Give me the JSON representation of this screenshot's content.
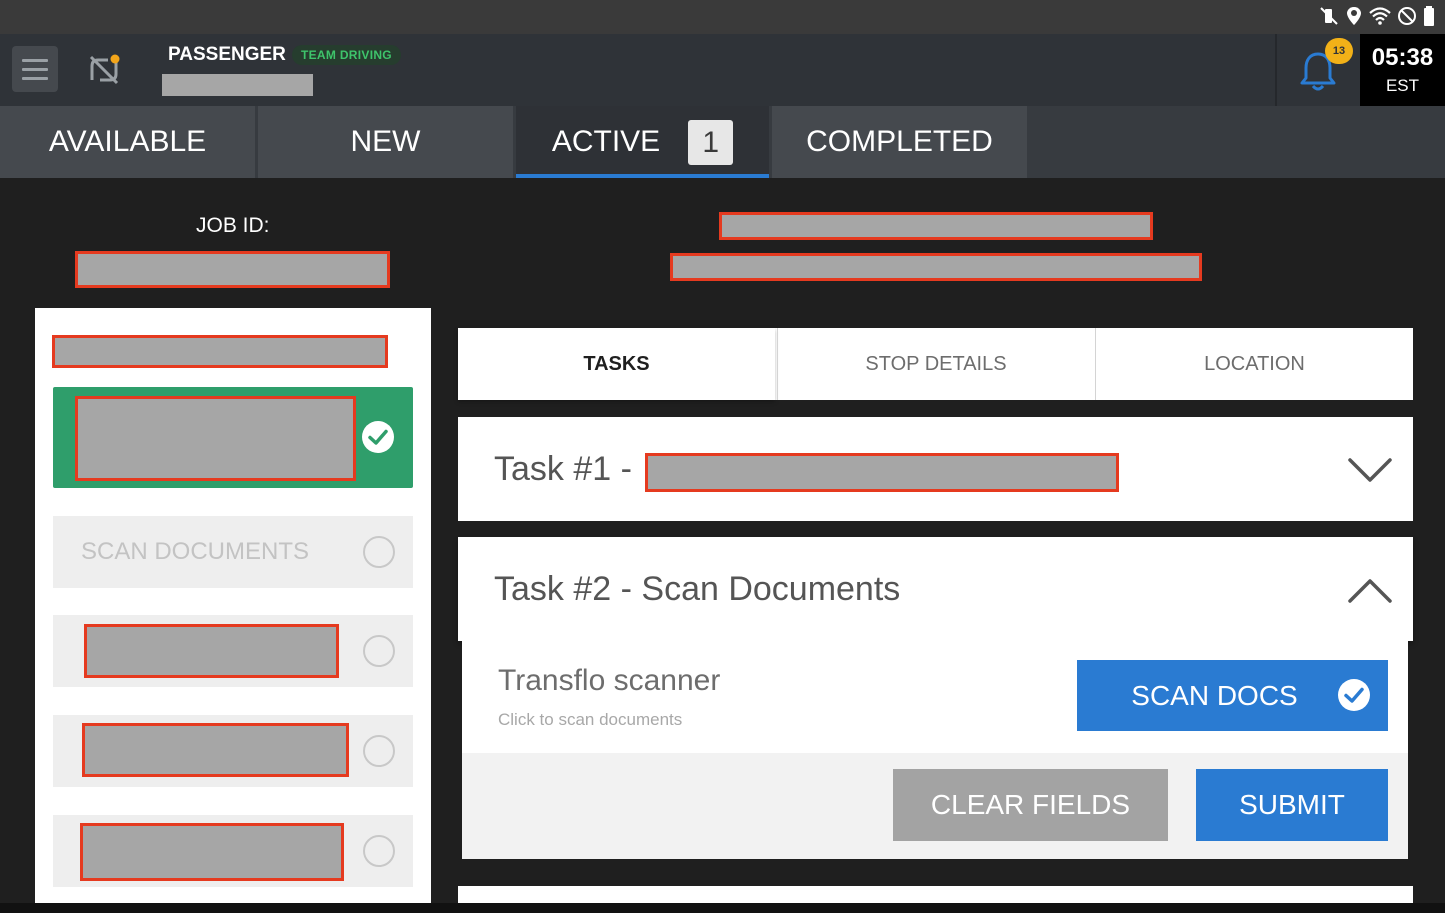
{
  "header": {
    "driver_role": "PASSENGER",
    "team_badge": "TEAM DRIVING",
    "notification_count": "13",
    "clock_time": "05:38",
    "clock_zone": "EST"
  },
  "tabs": [
    {
      "label": "AVAILABLE"
    },
    {
      "label": "NEW"
    },
    {
      "label": "ACTIVE",
      "count": "1"
    },
    {
      "label": "COMPLETED"
    }
  ],
  "job": {
    "id_label": "JOB ID:"
  },
  "steps": {
    "scan_label": "SCAN DOCUMENTS"
  },
  "subtabs": [
    {
      "label": "TASKS"
    },
    {
      "label": "STOP DETAILS"
    },
    {
      "label": "LOCATION"
    }
  ],
  "tasks": {
    "task1_prefix": "Task #1 -",
    "task2_title": "Task #2 - Scan Documents",
    "scanner_title": "Transflo scanner",
    "scanner_subtitle": "Click to scan documents",
    "scan_button": "SCAN DOCS",
    "clear_button": "CLEAR FIELDS",
    "submit_button": "SUBMIT"
  },
  "colors": {
    "accent_blue": "#2a7bd2",
    "done_green": "#2f9e6b",
    "badge_yellow": "#f2b118",
    "redaction_border": "#e53a1f"
  }
}
